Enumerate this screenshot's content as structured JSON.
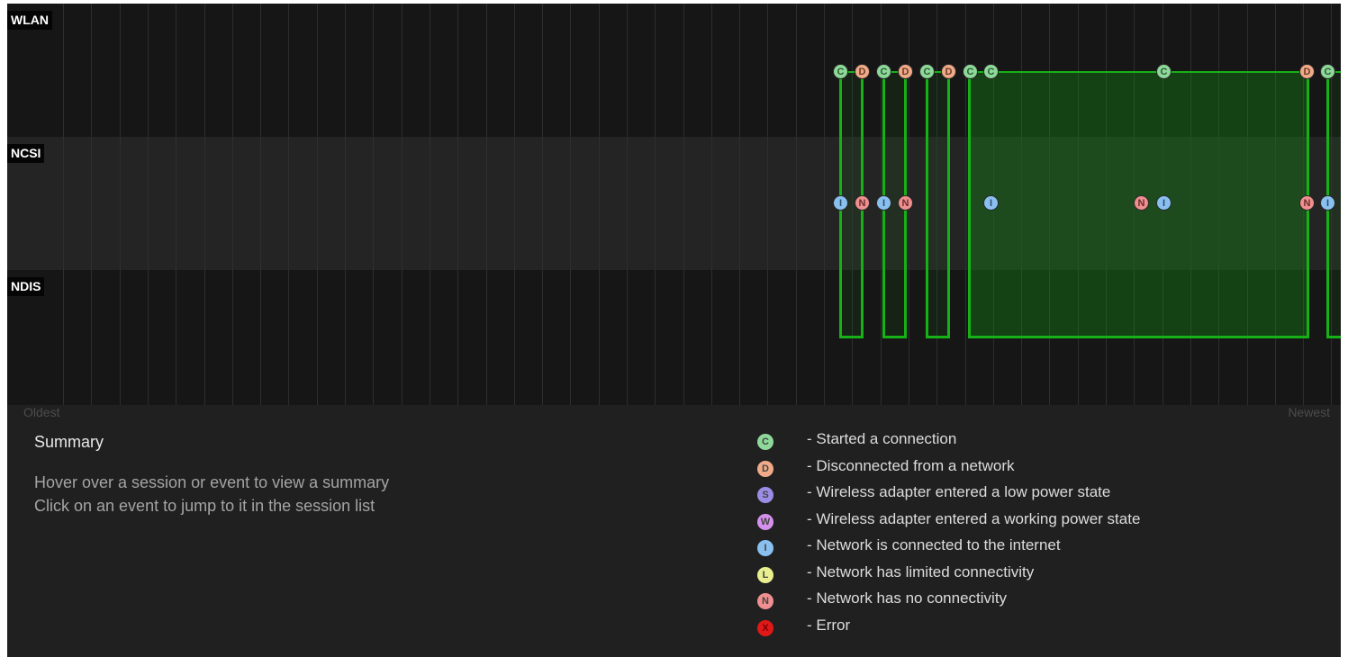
{
  "lanes": {
    "wlan": "WLAN",
    "ncsi": "NCSI",
    "ndis": "NDIS"
  },
  "axis": {
    "oldest": "Oldest",
    "newest": "Newest"
  },
  "summary": {
    "title": "Summary",
    "hint1": "Hover over a session or event to view a summary",
    "hint2": "Click on an event to jump to it in the session list"
  },
  "markers": {
    "wlan": [
      "C",
      "D",
      "C",
      "D",
      "C",
      "D",
      "C",
      "C",
      "C",
      "D",
      "C"
    ],
    "ncsi": [
      "I",
      "N",
      "I",
      "N",
      "I",
      "N",
      "I",
      "N",
      "I"
    ]
  },
  "legend": [
    {
      "letter": "C",
      "text": "- Started a connection",
      "color": "#8ed89a",
      "icon": "started-connection-icon"
    },
    {
      "letter": "D",
      "text": "- Disconnected from a network",
      "color": "#f0aa88",
      "icon": "disconnected-icon"
    },
    {
      "letter": "S",
      "text": "- Wireless adapter entered a low power state",
      "color": "#9c8ce6",
      "icon": "low-power-icon"
    },
    {
      "letter": "W",
      "text": "- Wireless adapter entered a working power state",
      "color": "#d490ec",
      "icon": "working-power-icon"
    },
    {
      "letter": "I",
      "text": "- Network is connected to the internet",
      "color": "#8ac0ef",
      "icon": "internet-connected-icon"
    },
    {
      "letter": "L",
      "text": "- Network has limited connectivity",
      "color": "#e9ef8f",
      "icon": "limited-connectivity-icon"
    },
    {
      "letter": "N",
      "text": "- Network has no connectivity",
      "color": "#ef8f8f",
      "icon": "no-connectivity-icon"
    },
    {
      "letter": "X",
      "text": "- Error",
      "color": "#e01818",
      "icon": "error-icon"
    }
  ],
  "colors": {
    "session_border": "#16b116",
    "background": "#202020"
  }
}
